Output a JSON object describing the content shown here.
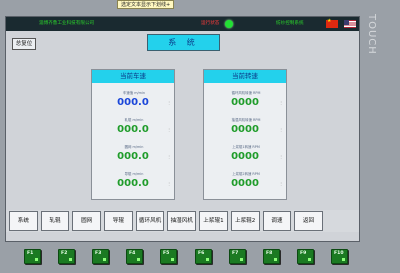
{
  "tooltip": "选定文本显示下划线+",
  "header": {
    "company": "淄博齐鲁工业科技有限公司",
    "status_label": "运行状态",
    "system_name": "纺纱控制系统",
    "status_color": "#22e034"
  },
  "reset_button": "总复位",
  "page_title": "系 统",
  "panels": {
    "speed": {
      "title": "当前车速",
      "rows": [
        {
          "label": "车速值 m/min",
          "value": "000.0"
        },
        {
          "label": "轧辊 m/min",
          "value": "000.0"
        },
        {
          "label": "圆网 m/min",
          "value": "000.0"
        },
        {
          "label": "导辊 m/min",
          "value": "000.0"
        }
      ]
    },
    "rpm": {
      "title": "当前转速",
      "rows": [
        {
          "label": "循环风机转速 RPM",
          "value": "0000"
        },
        {
          "label": "抽湿风机转速 RPM",
          "value": "0000"
        },
        {
          "label": "上浆辊1转速 RPM",
          "value": "0000"
        },
        {
          "label": "上浆辊2转速 RPM",
          "value": "0000"
        }
      ]
    }
  },
  "nav": [
    "系统",
    "轧辊",
    "圆网",
    "导辊",
    "循环风机",
    "抽湿风机",
    "上浆辊1",
    "上浆辊2",
    "调速",
    "返回"
  ],
  "side_label": "TOUCH",
  "function_keys": [
    "F1",
    "F2",
    "F3",
    "F4",
    "F5",
    "F6",
    "F7",
    "F8",
    "F9",
    "F10"
  ],
  "colors": {
    "accent": "#23d1ec",
    "value_blue": "#1a46d9",
    "value_green": "#1f9c2a",
    "fkey": "#1b7a22"
  }
}
